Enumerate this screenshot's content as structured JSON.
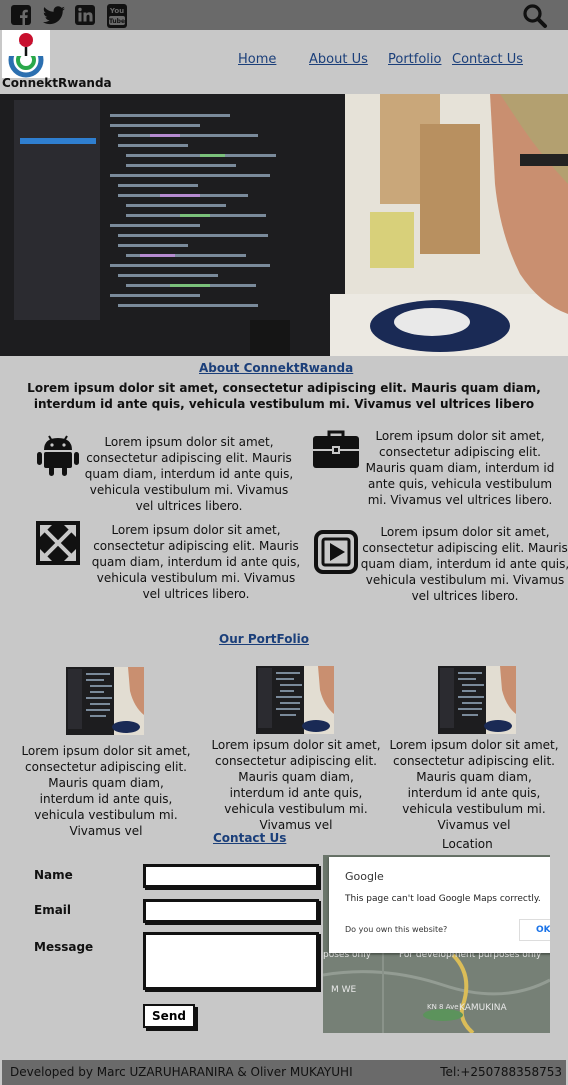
{
  "social_icons": [
    "facebook-icon",
    "twitter-icon",
    "linkedin-icon",
    "youtube-icon"
  ],
  "youtube_label_top": "You",
  "youtube_label_bottom": "Tube",
  "search_icon": "search-icon",
  "logo": {
    "text": "ConnektRwanda"
  },
  "nav": {
    "home": "Home",
    "about": "About Us",
    "portfolio": "Portfolio",
    "contact": "Contact Us"
  },
  "about": {
    "title": "About ConnektRwanda",
    "intro": "Lorem ipsum dolor sit amet, consectetur adipiscing elit. Mauris quam diam, interdum id ante quis, vehicula vestibulum mi. Vivamus vel ultrices libero"
  },
  "features": [
    {
      "icon": "android-icon",
      "text": "Lorem ipsum dolor sit amet, consectetur adipiscing elit. Mauris quam diam, interdum id ante quis, vehicula vestibulum mi. Vivamus vel ultrices libero."
    },
    {
      "icon": "briefcase-icon",
      "text": "Lorem ipsum dolor sit amet, consectetur adipiscing elit. Mauris quam diam, interdum id ante quis, vehicula vestibulum mi. Vivamus vel ultrices libero."
    },
    {
      "icon": "expand-arrows-icon",
      "text": "Lorem ipsum dolor sit amet, consectetur adipiscing elit. Mauris quam diam, interdum id ante quis, vehicula vestibulum mi. Vivamus vel ultrices libero."
    },
    {
      "icon": "play-icon",
      "text": "Lorem ipsum dolor sit amet, consectetur adipiscing elit. Mauris quam diam, interdum id ante quis, vehicula vestibulum mi. Vivamus vel ultrices libero."
    }
  ],
  "portfolio": {
    "title": "Our PortFolio",
    "items": [
      {
        "text": "Lorem ipsum dolor sit amet, consectetur adipiscing elit. Mauris quam diam, interdum id ante quis, vehicula vestibulum mi. Vivamus vel"
      },
      {
        "text": "Lorem ipsum dolor sit amet, consectetur adipiscing elit. Mauris quam diam, interdum id ante quis, vehicula vestibulum mi. Vivamus vel"
      },
      {
        "text": "Lorem ipsum dolor sit amet, consectetur adipiscing elit. Mauris quam diam, interdum id ante quis, vehicula vestibulum mi. Vivamus vel"
      }
    ]
  },
  "contact": {
    "title": "Contact Us",
    "name_label": "Name",
    "email_label": "Email",
    "message_label": "Message",
    "send_label": "Send",
    "location_label": "Location"
  },
  "map": {
    "google": "Google",
    "message": "This page can't load Google Maps correctly.",
    "own": "Do you own this website?",
    "ok": "OK",
    "dev_left": "poses only",
    "dev_right": "For development purposes only",
    "place1": "M WE",
    "place2": "KAMUKINA",
    "place3": "KN 8 Ave"
  },
  "footer": {
    "credits": "Developed by Marc UZARUHARANIRA & Oliver MUKAYUHI",
    "tel": "Tel:+250788358753"
  },
  "colors": {
    "topbar": "#6a6a6a",
    "background": "#c8c8c8",
    "link": "#1b3f7a"
  }
}
